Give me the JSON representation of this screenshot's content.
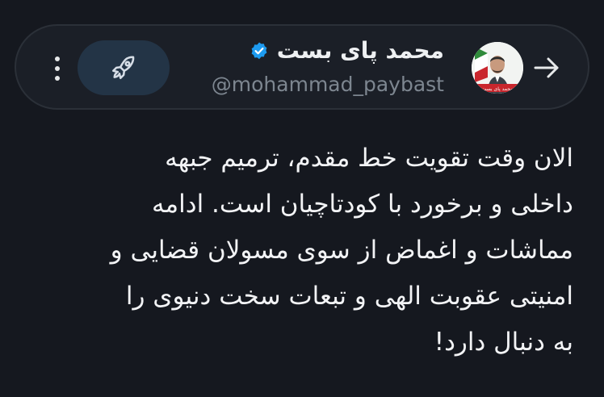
{
  "header": {
    "display_name": "محمد پای بست",
    "handle": "@mohammad_paybast",
    "avatar_caption": "محمد پای بست",
    "icons": {
      "back": "arrow-right-icon",
      "verified": "verified-badge-icon",
      "boost": "rocket-icon",
      "more": "more-vertical-icon"
    }
  },
  "tweet": {
    "lines": [
      "الان وقت تقویت خط مقدم، ترمیم جبهه",
      "داخلی و برخورد با کودتاچیان است. ادامه",
      "مماشات و اغماض از سوی مسولان قضایی و",
      "امنیتی عقوبت الهی و تبعات سخت دنیوی را",
      "به دنبال دارد!"
    ]
  },
  "colors": {
    "background": "#15181f",
    "header_bg": "#1b1f27",
    "header_border": "#2b3038",
    "boost_bg": "#233446",
    "verified": "#1d9bf0",
    "text_primary": "#f2f3f5",
    "text_secondary": "#7d8690"
  }
}
